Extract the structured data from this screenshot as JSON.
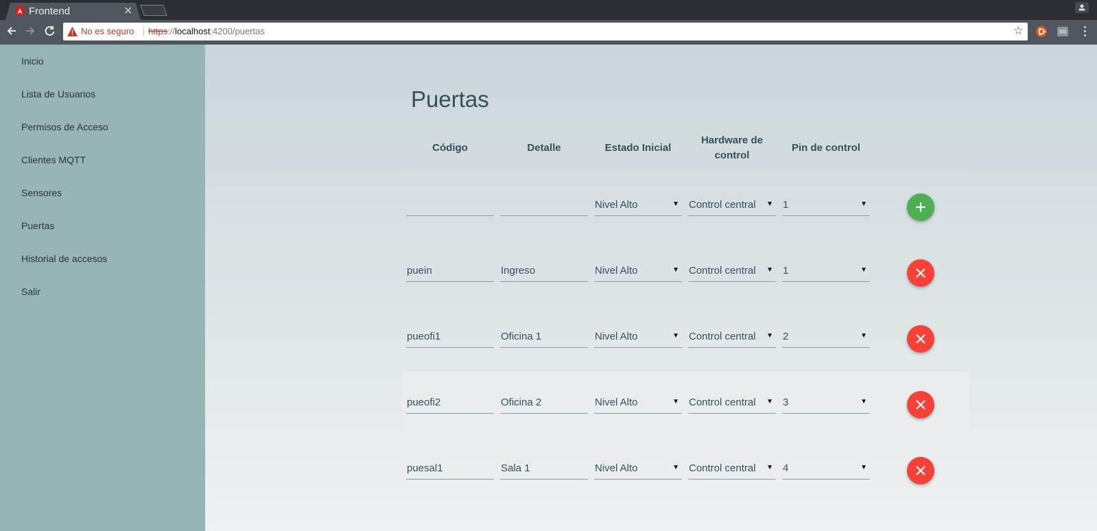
{
  "browser": {
    "tab_title": "Frontend",
    "security_label": "No es seguro",
    "url_scheme": "https",
    "url_sep": "://",
    "url_host": "localhost",
    "url_rest": ":4200/puertas"
  },
  "sidebar": {
    "items": [
      {
        "label": "Inicio"
      },
      {
        "label": "Lista de Usuarios"
      },
      {
        "label": "Permisos de Acceso"
      },
      {
        "label": "Clientes MQTT"
      },
      {
        "label": "Sensores"
      },
      {
        "label": "Puertas"
      },
      {
        "label": "Historial de accesos"
      },
      {
        "label": "Salir"
      }
    ]
  },
  "page": {
    "title": "Puertas",
    "columns": [
      "Código",
      "Detalle",
      "Estado Inicial",
      "Hardware de control",
      "Pin de control"
    ],
    "new_row": {
      "codigo": "",
      "detalle": "",
      "estado": "Nivel Alto",
      "hardware": "Control central",
      "pin": "1"
    },
    "rows": [
      {
        "codigo": "puein",
        "detalle": "Ingreso",
        "estado": "Nivel Alto",
        "hardware": "Control central",
        "pin": "1"
      },
      {
        "codigo": "pueofi1",
        "detalle": "Oficina 1",
        "estado": "Nivel Alto",
        "hardware": "Control central",
        "pin": "2"
      },
      {
        "codigo": "pueofi2",
        "detalle": "Oficina 2",
        "estado": "Nivel Alto",
        "hardware": "Control central",
        "pin": "3"
      },
      {
        "codigo": "puesal1",
        "detalle": "Sala 1",
        "estado": "Nivel Alto",
        "hardware": "Control central",
        "pin": "4"
      }
    ]
  },
  "icons": {
    "add": "plus-icon",
    "delete": "close-icon"
  },
  "colors": {
    "sidebar": "#97b4b7",
    "add_button": "#4caf50",
    "delete_button": "#f44336",
    "title": "#34505a"
  }
}
